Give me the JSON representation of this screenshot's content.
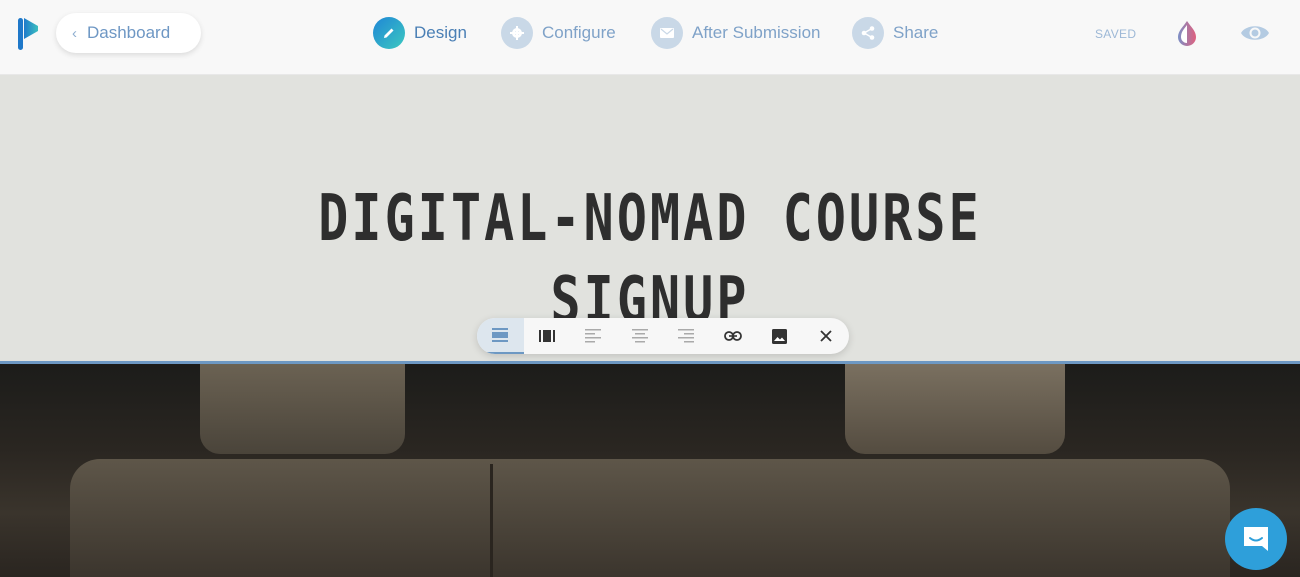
{
  "header": {
    "back_label": "Dashboard",
    "nav": [
      {
        "label": "Design",
        "icon": "pencil-icon",
        "active": true
      },
      {
        "label": "Configure",
        "icon": "gear-icon",
        "active": false
      },
      {
        "label": "After Submission",
        "icon": "envelope-icon",
        "active": false
      },
      {
        "label": "Share",
        "icon": "share-icon",
        "active": false
      }
    ],
    "status": "SAVED"
  },
  "hero": {
    "title_line1": "DIGITAL-NOMAD COURSE",
    "title_line2": "SIGNUP"
  },
  "toolbar": {
    "buttons": [
      "full-width-layout",
      "boxed-layout",
      "align-left",
      "align-center",
      "align-right",
      "link",
      "image",
      "close"
    ]
  },
  "colors": {
    "accent": "#6d98c3",
    "nav_text": "#7fa2c8",
    "chat": "#2e9fda"
  }
}
